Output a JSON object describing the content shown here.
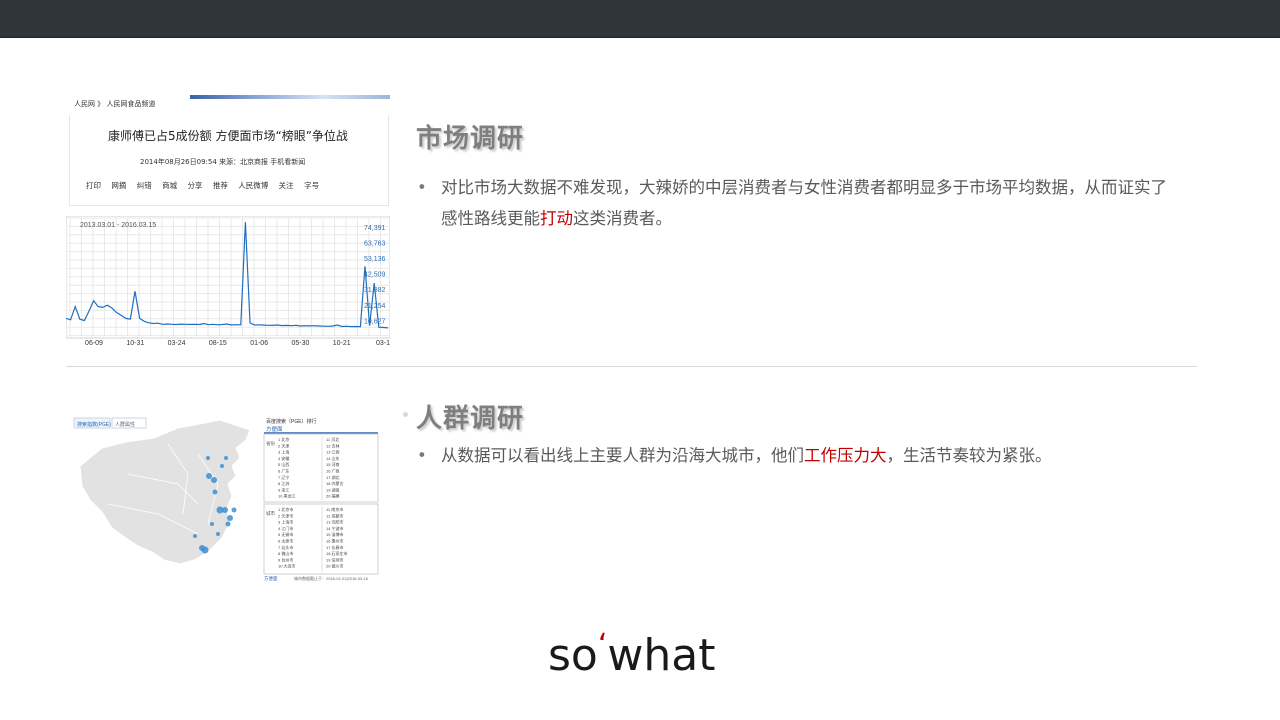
{
  "section1": {
    "title": "市场调研",
    "bullet_before": "对比市场大数据不难发现，大辣娇的中层消费者与女性消费者都明显多于市场平均数据，从而证实了感性路线更能",
    "bullet_highlight": "打动",
    "bullet_after": "这类消费者。"
  },
  "section2": {
    "title": "人群调研",
    "bullet_before": "从数据可以看出线上主要人群为沿海大城市，他们",
    "bullet_highlight": "工作压力大",
    "bullet_after": "，生活节奏较为紧张。"
  },
  "footer": {
    "so": "so",
    "quote": "‘",
    "what": "what"
  },
  "news_clip": {
    "breadcrumb": "人民网 》 人民网食品频道",
    "headline": "康师傅已占5成份额 方便面市场“榜眼”争位战",
    "meta": "2014年08月26日09:54   来源：北京商报   手机看新闻",
    "toolbar": "打印 网摘 纠错 商城 分享 推荐 人民微博 关注 字号"
  },
  "chart_data": {
    "type": "line",
    "title": "2013.03.01 - 2016.03.15",
    "x_ticks": [
      "06-09",
      "10-31",
      "03-24",
      "08-15",
      "01-06",
      "05-30",
      "10-21",
      "03-1"
    ],
    "y_ticks": [
      10627,
      21254,
      31882,
      42509,
      53136,
      63763,
      74391
    ],
    "y_tick_labels": [
      "10,627",
      "21,254",
      "31,882",
      "42,509",
      "53,136",
      "63,763",
      "74,391"
    ],
    "ylim": [
      0,
      79000
    ],
    "series": [
      {
        "values": [
          12000,
          11000,
          20000,
          11500,
          10500,
          17000,
          24000,
          20000,
          19500,
          21000,
          19000,
          16000,
          14000,
          12000,
          11500,
          30500,
          12000,
          10000,
          9000,
          8500,
          8700,
          8000,
          8200,
          8000,
          7800,
          8100,
          8000,
          7900,
          8000,
          7800,
          8500,
          7700,
          8000,
          7600,
          7800,
          8200,
          7500,
          7700,
          7600,
          77500,
          9000,
          7500,
          7600,
          7400,
          7300,
          7200,
          7500,
          7100,
          7200,
          7000,
          7300,
          6800,
          7000,
          6900,
          7000,
          6800,
          6700,
          6600,
          6800,
          7500,
          6500,
          6600,
          6400,
          6500,
          6300,
          47500,
          7000,
          36000,
          6000,
          5800,
          5500
        ]
      }
    ],
    "grid": true,
    "line_color": "#1f6fc1"
  },
  "map_panel": {
    "tabs": [
      "搜索指数(PGE)",
      "人群属性"
    ],
    "rank_title": "百度搜索（PGE）排行",
    "rank_subtitle": "方便面",
    "province_header": "省份",
    "city_header": "城市",
    "provinces": [
      "1 北京",
      "2 天津",
      "3 上海",
      "4 安徽",
      "5 山西",
      "6 广东",
      "7 辽宁",
      "8 江苏",
      "9 浙江",
      "10 黑龙江",
      "11 河北",
      "12 吉林",
      "13 江西",
      "14 山东",
      "15 河南",
      "16 广西",
      "17 湖北",
      "18 内蒙古",
      "19 湖南",
      "20 福建"
    ],
    "cities": [
      "1 北京市",
      "2 天津市",
      "3 上海市",
      "4 江门市",
      "5 无锡市",
      "6 太原市",
      "7 汕头市",
      "8 佛山市",
      "9 台州市",
      "10 大连市",
      "11 南京市",
      "12 成都市",
      "13 沈阳市",
      "14 宁波市",
      "15 淄博市",
      "16 惠州市",
      "17 长春市",
      "18 石家庄市",
      "19 深圳市",
      "20 银川市"
    ],
    "footer_left": "方便面",
    "footer_right": "城市数据截止于：2016-01-01|2016-03-16"
  }
}
